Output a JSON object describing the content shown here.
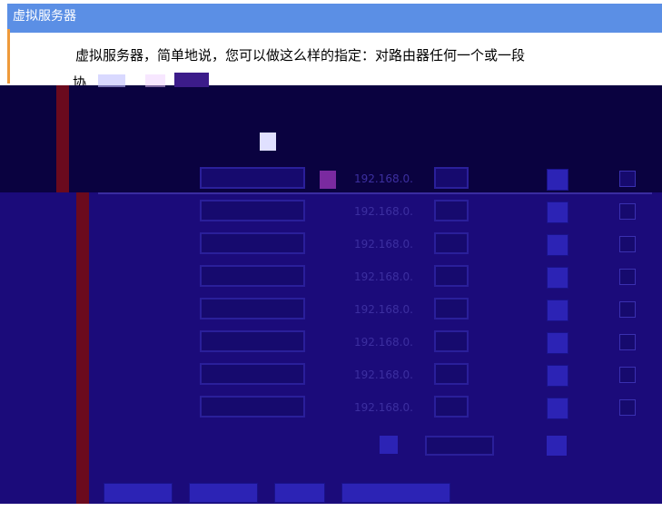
{
  "window": {
    "title": "虚拟服务器"
  },
  "intro": {
    "line1": "虚拟服务器，简单地说，您可以做这么样的指定：对路由器任何一个或一段",
    "line2_fragment": "协"
  },
  "table": {
    "rows": [
      {
        "num": "",
        "ip_prefix": "192.168.0."
      },
      {
        "num": "",
        "ip_prefix": "192.168.0."
      },
      {
        "num": "",
        "ip_prefix": "192.168.0."
      },
      {
        "num": "",
        "ip_prefix": "192.168.0."
      },
      {
        "num": "",
        "ip_prefix": "192.168.0."
      },
      {
        "num": "",
        "ip_prefix": "192.168.0."
      },
      {
        "num": "",
        "ip_prefix": "192.168.0."
      },
      {
        "num": "",
        "ip_prefix": "192.168.0."
      }
    ]
  },
  "colors": {
    "title_bar": "#5b8fe5",
    "glitch_background": "#1b0b7a",
    "accent_red": "#6b0a1e"
  }
}
